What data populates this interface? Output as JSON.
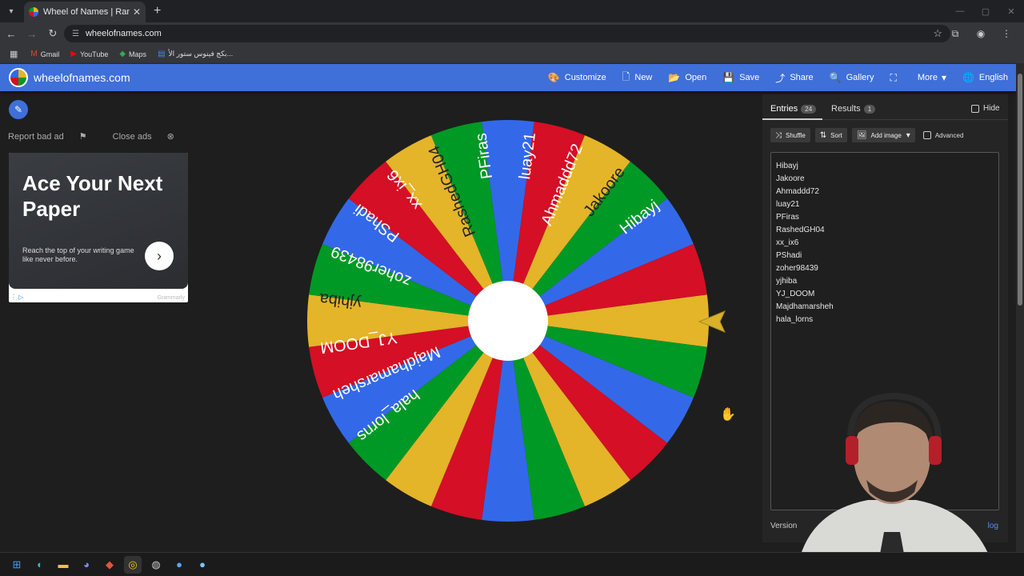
{
  "browser": {
    "tab_title": "Wheel of Names | Random nam",
    "url": "wheelofnames.com",
    "bookmarks": [
      "Gmail",
      "YouTube",
      "Maps",
      "بكج فينوس ستور الأ..."
    ]
  },
  "header": {
    "site_name": "wheelofnames.com",
    "nav": [
      {
        "label": "Customize",
        "icon": "palette-icon"
      },
      {
        "label": "New",
        "icon": "file-icon"
      },
      {
        "label": "Open",
        "icon": "folder-icon"
      },
      {
        "label": "Save",
        "icon": "save-icon"
      },
      {
        "label": "Share",
        "icon": "share-icon"
      },
      {
        "label": "Gallery",
        "icon": "search-icon"
      },
      {
        "label": "",
        "icon": "fullscreen-icon"
      },
      {
        "label": "More",
        "icon": "chevron-down-icon"
      },
      {
        "label": "English",
        "icon": "globe-icon"
      }
    ]
  },
  "ads": {
    "report_label": "Report bad ad",
    "close_label": "Close ads",
    "title": "Ace Your Next Paper",
    "text": "Reach the top of your writing game like never before.",
    "brand": "Grammarly"
  },
  "wheel": {
    "segment_colors": [
      "#e4b429",
      "#009925",
      "#3369e8",
      "#d50f25"
    ],
    "segment_count": 24,
    "labels": [
      "Hibayj",
      "Jakoore",
      "Ahmaddd72",
      "luay21",
      "PFiras",
      "RashedGH04",
      "xx_ix6",
      "PShadi",
      "zoher98439",
      "yjhiba",
      "YJ_DOOM",
      "Majdhamarsheh",
      "hala_lorns"
    ]
  },
  "panel": {
    "entries_tab": "Entries",
    "entries_count": "24",
    "results_tab": "Results",
    "results_count": "1",
    "hide_label": "Hide",
    "shuffle_label": "Shuffle",
    "sort_label": "Sort",
    "add_image_label": "Add image",
    "advanced_label": "Advanced",
    "entries": [
      "Hibayj",
      "Jakoore",
      "Ahmaddd72",
      "luay21",
      "PFiras",
      "RashedGH04",
      "xx_ix6",
      "PShadi",
      "zoher98439",
      "yjhiba",
      "YJ_DOOM",
      "Majdhamarsheh",
      "hala_lorns"
    ],
    "version_label": "Version",
    "changelog_label": "log"
  }
}
